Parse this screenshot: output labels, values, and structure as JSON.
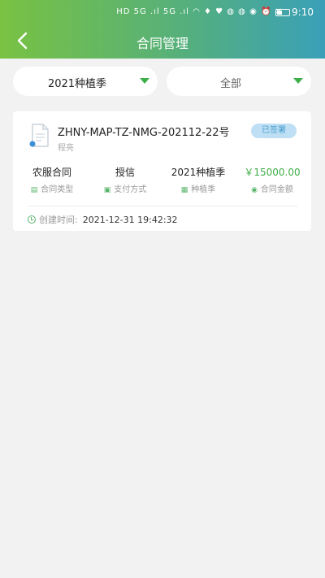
{
  "status_bar": {
    "icons_text": "HD 5G .ıl 5G .ıl ◠ ♦ ♥ ◍ ◍ ◉ ⏰ ✕",
    "time": "9:10"
  },
  "header": {
    "title": "合同管理",
    "back_icon": "chevron-left-icon"
  },
  "filters": {
    "season": "2021种植季",
    "status": "全部"
  },
  "contract": {
    "number": "ZHNY-MAP-TZ-NMG-202112-22号",
    "signer": "程亮",
    "status_badge": "已签署",
    "contract_type_value": "农服合同",
    "contract_type_label": "合同类型",
    "payment_value": "授信",
    "payment_label": "支付方式",
    "season_value": "2021种植季",
    "season_label": "种植季",
    "amount_value": "￥15000.00",
    "amount_label": "合同金额",
    "created_label": "创建时间:",
    "created_time": "2021-12-31 19:42:32"
  },
  "colors": {
    "accent_green": "#3fae49",
    "badge_bg": "#bfe0f4",
    "badge_text": "#4a9ed0"
  }
}
